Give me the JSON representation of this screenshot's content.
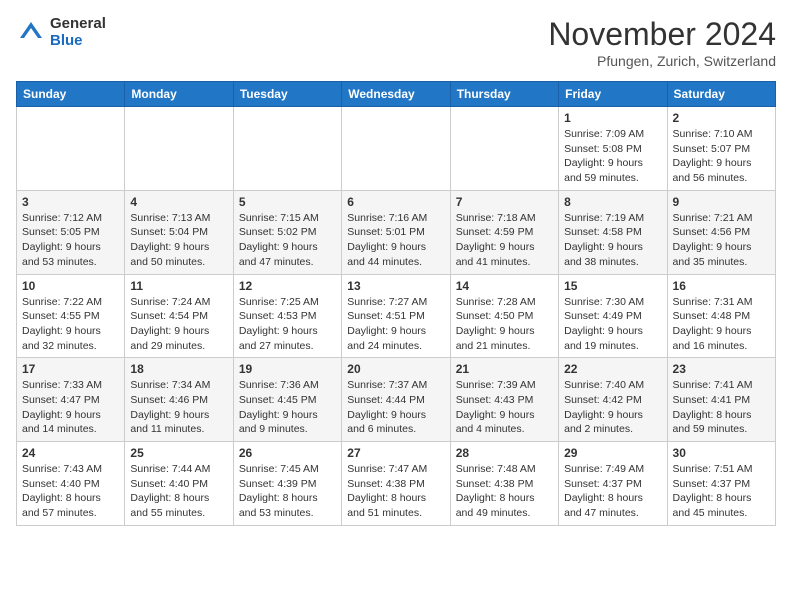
{
  "logo": {
    "general": "General",
    "blue": "Blue"
  },
  "title": "November 2024",
  "location": "Pfungen, Zurich, Switzerland",
  "weekdays": [
    "Sunday",
    "Monday",
    "Tuesday",
    "Wednesday",
    "Thursday",
    "Friday",
    "Saturday"
  ],
  "weeks": [
    [
      {
        "day": "",
        "info": ""
      },
      {
        "day": "",
        "info": ""
      },
      {
        "day": "",
        "info": ""
      },
      {
        "day": "",
        "info": ""
      },
      {
        "day": "",
        "info": ""
      },
      {
        "day": "1",
        "info": "Sunrise: 7:09 AM\nSunset: 5:08 PM\nDaylight: 9 hours\nand 59 minutes."
      },
      {
        "day": "2",
        "info": "Sunrise: 7:10 AM\nSunset: 5:07 PM\nDaylight: 9 hours\nand 56 minutes."
      }
    ],
    [
      {
        "day": "3",
        "info": "Sunrise: 7:12 AM\nSunset: 5:05 PM\nDaylight: 9 hours\nand 53 minutes."
      },
      {
        "day": "4",
        "info": "Sunrise: 7:13 AM\nSunset: 5:04 PM\nDaylight: 9 hours\nand 50 minutes."
      },
      {
        "day": "5",
        "info": "Sunrise: 7:15 AM\nSunset: 5:02 PM\nDaylight: 9 hours\nand 47 minutes."
      },
      {
        "day": "6",
        "info": "Sunrise: 7:16 AM\nSunset: 5:01 PM\nDaylight: 9 hours\nand 44 minutes."
      },
      {
        "day": "7",
        "info": "Sunrise: 7:18 AM\nSunset: 4:59 PM\nDaylight: 9 hours\nand 41 minutes."
      },
      {
        "day": "8",
        "info": "Sunrise: 7:19 AM\nSunset: 4:58 PM\nDaylight: 9 hours\nand 38 minutes."
      },
      {
        "day": "9",
        "info": "Sunrise: 7:21 AM\nSunset: 4:56 PM\nDaylight: 9 hours\nand 35 minutes."
      }
    ],
    [
      {
        "day": "10",
        "info": "Sunrise: 7:22 AM\nSunset: 4:55 PM\nDaylight: 9 hours\nand 32 minutes."
      },
      {
        "day": "11",
        "info": "Sunrise: 7:24 AM\nSunset: 4:54 PM\nDaylight: 9 hours\nand 29 minutes."
      },
      {
        "day": "12",
        "info": "Sunrise: 7:25 AM\nSunset: 4:53 PM\nDaylight: 9 hours\nand 27 minutes."
      },
      {
        "day": "13",
        "info": "Sunrise: 7:27 AM\nSunset: 4:51 PM\nDaylight: 9 hours\nand 24 minutes."
      },
      {
        "day": "14",
        "info": "Sunrise: 7:28 AM\nSunset: 4:50 PM\nDaylight: 9 hours\nand 21 minutes."
      },
      {
        "day": "15",
        "info": "Sunrise: 7:30 AM\nSunset: 4:49 PM\nDaylight: 9 hours\nand 19 minutes."
      },
      {
        "day": "16",
        "info": "Sunrise: 7:31 AM\nSunset: 4:48 PM\nDaylight: 9 hours\nand 16 minutes."
      }
    ],
    [
      {
        "day": "17",
        "info": "Sunrise: 7:33 AM\nSunset: 4:47 PM\nDaylight: 9 hours\nand 14 minutes."
      },
      {
        "day": "18",
        "info": "Sunrise: 7:34 AM\nSunset: 4:46 PM\nDaylight: 9 hours\nand 11 minutes."
      },
      {
        "day": "19",
        "info": "Sunrise: 7:36 AM\nSunset: 4:45 PM\nDaylight: 9 hours\nand 9 minutes."
      },
      {
        "day": "20",
        "info": "Sunrise: 7:37 AM\nSunset: 4:44 PM\nDaylight: 9 hours\nand 6 minutes."
      },
      {
        "day": "21",
        "info": "Sunrise: 7:39 AM\nSunset: 4:43 PM\nDaylight: 9 hours\nand 4 minutes."
      },
      {
        "day": "22",
        "info": "Sunrise: 7:40 AM\nSunset: 4:42 PM\nDaylight: 9 hours\nand 2 minutes."
      },
      {
        "day": "23",
        "info": "Sunrise: 7:41 AM\nSunset: 4:41 PM\nDaylight: 8 hours\nand 59 minutes."
      }
    ],
    [
      {
        "day": "24",
        "info": "Sunrise: 7:43 AM\nSunset: 4:40 PM\nDaylight: 8 hours\nand 57 minutes."
      },
      {
        "day": "25",
        "info": "Sunrise: 7:44 AM\nSunset: 4:40 PM\nDaylight: 8 hours\nand 55 minutes."
      },
      {
        "day": "26",
        "info": "Sunrise: 7:45 AM\nSunset: 4:39 PM\nDaylight: 8 hours\nand 53 minutes."
      },
      {
        "day": "27",
        "info": "Sunrise: 7:47 AM\nSunset: 4:38 PM\nDaylight: 8 hours\nand 51 minutes."
      },
      {
        "day": "28",
        "info": "Sunrise: 7:48 AM\nSunset: 4:38 PM\nDaylight: 8 hours\nand 49 minutes."
      },
      {
        "day": "29",
        "info": "Sunrise: 7:49 AM\nSunset: 4:37 PM\nDaylight: 8 hours\nand 47 minutes."
      },
      {
        "day": "30",
        "info": "Sunrise: 7:51 AM\nSunset: 4:37 PM\nDaylight: 8 hours\nand 45 minutes."
      }
    ]
  ]
}
